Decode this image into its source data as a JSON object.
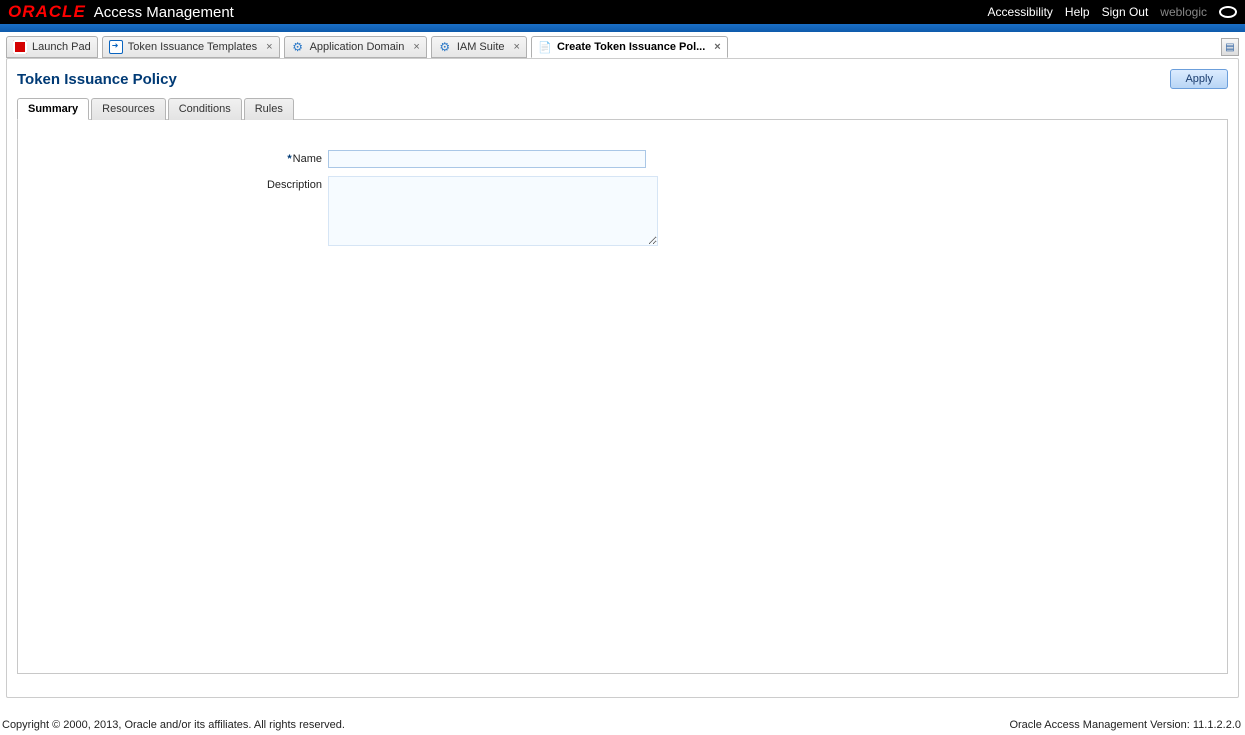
{
  "header": {
    "logo": "ORACLE",
    "app_title": "Access Management",
    "links": {
      "accessibility": "Accessibility",
      "help": "Help",
      "signout": "Sign Out"
    },
    "user": "weblogic"
  },
  "doc_tabs": [
    {
      "label": "Launch Pad",
      "closable": false
    },
    {
      "label": "Token Issuance Templates",
      "closable": true
    },
    {
      "label": "Application Domain",
      "closable": true
    },
    {
      "label": "IAM Suite",
      "closable": true
    },
    {
      "label": "Create Token Issuance Pol...",
      "closable": true,
      "active": true
    }
  ],
  "page": {
    "title": "Token Issuance Policy",
    "apply": "Apply"
  },
  "subtabs": {
    "summary": "Summary",
    "resources": "Resources",
    "conditions": "Conditions",
    "rules": "Rules"
  },
  "form": {
    "name_label": "Name",
    "name_value": "",
    "desc_label": "Description",
    "desc_value": ""
  },
  "footer": {
    "left": "Copyright © 2000, 2013, Oracle and/or its affiliates. All rights reserved.",
    "right": "Oracle Access Management Version: 11.1.2.2.0"
  }
}
